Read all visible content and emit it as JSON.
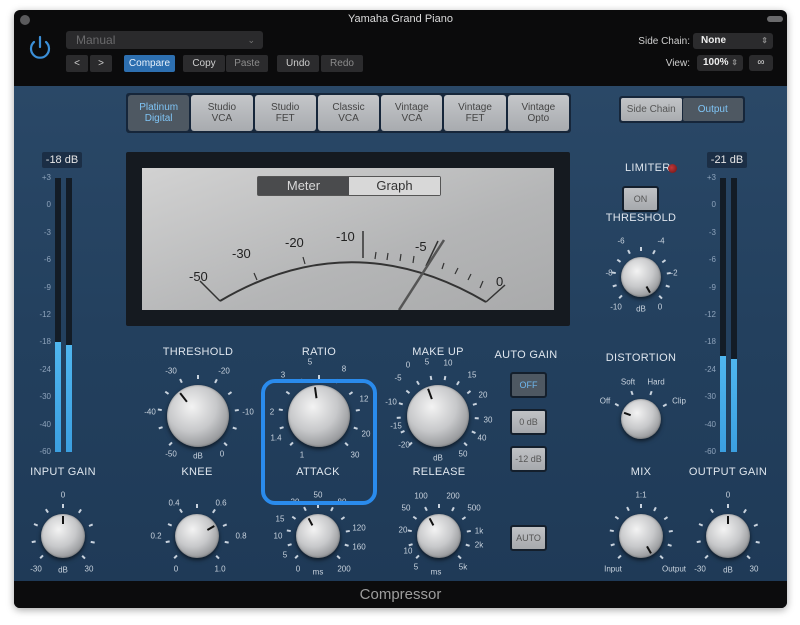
{
  "window": {
    "title": "Yamaha Grand Piano",
    "footer_title": "Compressor"
  },
  "header": {
    "power_icon": "power-icon",
    "preset": {
      "value": "Manual"
    },
    "nav": {
      "prev": "<",
      "next": ">"
    },
    "buttons": {
      "compare": "Compare",
      "copy": "Copy",
      "paste": "Paste",
      "undo": "Undo",
      "redo": "Redo"
    },
    "side_chain": {
      "label": "Side Chain:",
      "value": "None"
    },
    "view": {
      "label": "View:",
      "value": "100%"
    },
    "link_icon": "link-icon"
  },
  "models": [
    {
      "line1": "Platinum",
      "line2": "Digital",
      "active": true
    },
    {
      "line1": "Studio",
      "line2": "VCA",
      "active": false
    },
    {
      "line1": "Studio",
      "line2": "FET",
      "active": false
    },
    {
      "line1": "Classic",
      "line2": "VCA",
      "active": false
    },
    {
      "line1": "Vintage",
      "line2": "VCA",
      "active": false
    },
    {
      "line1": "Vintage",
      "line2": "FET",
      "active": false
    },
    {
      "line1": "Vintage",
      "line2": "Opto",
      "active": false
    }
  ],
  "sidechain_output": {
    "side_chain": "Side Chain",
    "output": "Output",
    "selected": "Output"
  },
  "input_meter": {
    "readout": "-18 dB",
    "scale": [
      "+3",
      "0",
      "-3",
      "-6",
      "-9",
      "-12",
      "-18",
      "-24",
      "-30",
      "-40",
      "-60"
    ],
    "level_db": -18
  },
  "output_meter": {
    "readout": "-21 dB",
    "scale": [
      "+3",
      "0",
      "-3",
      "-6",
      "-9",
      "-12",
      "-18",
      "-24",
      "-30",
      "-40",
      "-60"
    ],
    "level_db": -21
  },
  "vu": {
    "tabs": {
      "meter": "Meter",
      "graph": "Graph",
      "selected": "Meter"
    },
    "scale": [
      "-50",
      "-30",
      "-20",
      "-10",
      "-5",
      "0"
    ],
    "needle_db": -5
  },
  "knobs": {
    "threshold": {
      "label": "THRESHOLD",
      "unit": "dB",
      "ticks": [
        "-30",
        "-20",
        "-40",
        "-10",
        "-50",
        "0"
      ]
    },
    "ratio": {
      "label": "RATIO",
      "ticks": [
        "5",
        "3",
        "8",
        "2",
        "12",
        "1.4",
        "20",
        "1",
        "30"
      ]
    },
    "makeup": {
      "label": "MAKE UP",
      "unit": "dB",
      "ticks": [
        "5",
        "0",
        "10",
        "-5",
        "15",
        "-10",
        "20",
        "-15",
        "30",
        "-20",
        "40",
        "50"
      ]
    },
    "input_gain": {
      "label": "INPUT GAIN",
      "unit": "dB",
      "ticks": [
        "0",
        "-30",
        "30"
      ]
    },
    "knee": {
      "label": "KNEE",
      "ticks": [
        "0.4",
        "0.6",
        "0.2",
        "0.8",
        "0",
        "1.0"
      ]
    },
    "attack": {
      "label": "ATTACK",
      "unit": "ms",
      "ticks": [
        "50",
        "20",
        "80",
        "15",
        "120",
        "10",
        "160",
        "5",
        "200",
        "0"
      ]
    },
    "release": {
      "label": "RELEASE",
      "unit": "ms",
      "ticks": [
        "100",
        "200",
        "50",
        "500",
        "20",
        "1k",
        "10",
        "2k",
        "5",
        "5k"
      ]
    },
    "limiter_threshold": {
      "label": "THRESHOLD",
      "unit": "dB",
      "ticks": [
        "-6",
        "-4",
        "-8",
        "-2",
        "-10",
        "0"
      ]
    },
    "distortion": {
      "label": "DISTORTION",
      "ticks": [
        "Soft",
        "Hard",
        "Off",
        "Clip"
      ]
    },
    "mix": {
      "label": "MIX",
      "ticks": [
        "1:1",
        "Input",
        "Output"
      ]
    },
    "output_gain": {
      "label": "OUTPUT GAIN",
      "unit": "dB",
      "ticks": [
        "0",
        "-30",
        "30"
      ]
    }
  },
  "auto_gain": {
    "label": "AUTO GAIN",
    "off": "OFF",
    "zero_db": "0 dB",
    "minus12": "-12 dB",
    "selected": "OFF"
  },
  "auto_button": "AUTO",
  "limiter": {
    "label": "LIMITER",
    "on": "ON"
  }
}
